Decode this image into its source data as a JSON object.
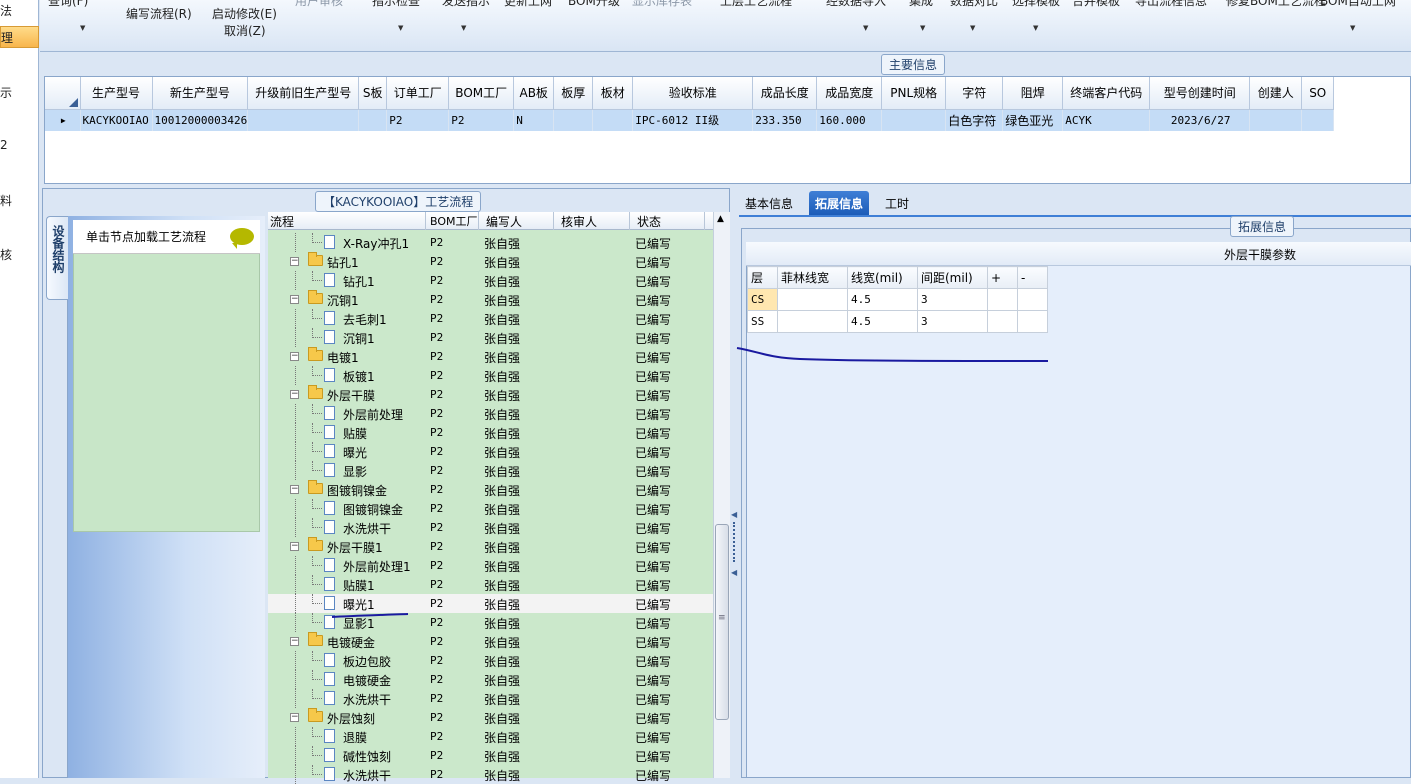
{
  "left_strip": [
    "法",
    "理",
    "示",
    "2",
    "料",
    "核"
  ],
  "toolbar": {
    "row1": [
      "查询(F)",
      "用户审核",
      "指示检查",
      "发送指示",
      "更新上网",
      "BOM升级",
      "显示库存表",
      "上层工艺流程",
      "经数据导入",
      "集成",
      "数据对比",
      "选择模板",
      "合并模板",
      "导出流程信息",
      "修复BOM工艺流程",
      "BOM自动上网"
    ],
    "compile_flow": "编写流程(R)",
    "start_modify": "启动修改(E)",
    "cancel": "取消(Z)"
  },
  "main_info": {
    "title": "主要信息",
    "columns": [
      "生产型号",
      "新生产型号",
      "升级前旧生产型号",
      "S板",
      "订单工厂",
      "BOM工厂",
      "AB板",
      "板厚",
      "板材",
      "验收标准",
      "成品长度",
      "成品宽度",
      "PNL规格",
      "字符",
      "阻焊",
      "终端客户代码",
      "型号创建时间",
      "创建人",
      "SO"
    ],
    "row": [
      "KACYKOOIAO",
      "10012000003426",
      "",
      "",
      "P2",
      "P2",
      "N",
      "",
      "",
      "IPC-6012 II级",
      "233.350",
      "160.000",
      "",
      "白色字符",
      "绿色亚光",
      "ACYK",
      "2023/6/27",
      "",
      ""
    ]
  },
  "process": {
    "title": "【KACYKOOIAO】工艺流程",
    "side_tab": "设备结构",
    "click_hint": "单击节点加载工艺流程",
    "columns": [
      "流程",
      "BOM工厂",
      "编写人",
      "核审人",
      "状态"
    ],
    "rows": [
      {
        "name": "X-Ray冲孔1",
        "level": 1,
        "factory": "P2",
        "writer": "张自强",
        "status": "已编写"
      },
      {
        "name": "钻孔1",
        "level": 0,
        "factory": "P2",
        "writer": "张自强",
        "status": "已编写"
      },
      {
        "name": "钻孔1",
        "level": 1,
        "factory": "P2",
        "writer": "张自强",
        "status": "已编写"
      },
      {
        "name": "沉铜1",
        "level": 0,
        "factory": "P2",
        "writer": "张自强",
        "status": "已编写"
      },
      {
        "name": "去毛刺1",
        "level": 1,
        "factory": "P2",
        "writer": "张自强",
        "status": "已编写"
      },
      {
        "name": "沉铜1",
        "level": 1,
        "factory": "P2",
        "writer": "张自强",
        "status": "已编写"
      },
      {
        "name": "电镀1",
        "level": 0,
        "factory": "P2",
        "writer": "张自强",
        "status": "已编写"
      },
      {
        "name": "板镀1",
        "level": 1,
        "factory": "P2",
        "writer": "张自强",
        "status": "已编写"
      },
      {
        "name": "外层干膜",
        "level": 0,
        "factory": "P2",
        "writer": "张自强",
        "status": "已编写"
      },
      {
        "name": "外层前处理",
        "level": 1,
        "factory": "P2",
        "writer": "张自强",
        "status": "已编写"
      },
      {
        "name": "贴膜",
        "level": 1,
        "factory": "P2",
        "writer": "张自强",
        "status": "已编写"
      },
      {
        "name": "曝光",
        "level": 1,
        "factory": "P2",
        "writer": "张自强",
        "status": "已编写"
      },
      {
        "name": "显影",
        "level": 1,
        "factory": "P2",
        "writer": "张自强",
        "status": "已编写"
      },
      {
        "name": "图镀铜镍金",
        "level": 0,
        "factory": "P2",
        "writer": "张自强",
        "status": "已编写"
      },
      {
        "name": "图镀铜镍金",
        "level": 1,
        "factory": "P2",
        "writer": "张自强",
        "status": "已编写"
      },
      {
        "name": "水洗烘干",
        "level": 1,
        "factory": "P2",
        "writer": "张自强",
        "status": "已编写"
      },
      {
        "name": "外层干膜1",
        "level": 0,
        "factory": "P2",
        "writer": "张自强",
        "status": "已编写"
      },
      {
        "name": "外层前处理1",
        "level": 1,
        "factory": "P2",
        "writer": "张自强",
        "status": "已编写"
      },
      {
        "name": "贴膜1",
        "level": 1,
        "factory": "P2",
        "writer": "张自强",
        "status": "已编写"
      },
      {
        "name": "曝光1",
        "level": 1,
        "factory": "P2",
        "writer": "张自强",
        "status": "已编写",
        "selected": true
      },
      {
        "name": "显影1",
        "level": 1,
        "factory": "P2",
        "writer": "张自强",
        "status": "已编写"
      },
      {
        "name": "电镀硬金",
        "level": 0,
        "factory": "P2",
        "writer": "张自强",
        "status": "已编写"
      },
      {
        "name": "板边包胶",
        "level": 1,
        "factory": "P2",
        "writer": "张自强",
        "status": "已编写"
      },
      {
        "name": "电镀硬金",
        "level": 1,
        "factory": "P2",
        "writer": "张自强",
        "status": "已编写"
      },
      {
        "name": "水洗烘干",
        "level": 1,
        "factory": "P2",
        "writer": "张自强",
        "status": "已编写"
      },
      {
        "name": "外层蚀刻",
        "level": 0,
        "factory": "P2",
        "writer": "张自强",
        "status": "已编写"
      },
      {
        "name": "退膜",
        "level": 1,
        "factory": "P2",
        "writer": "张自强",
        "status": "已编写"
      },
      {
        "name": "碱性蚀刻",
        "level": 1,
        "factory": "P2",
        "writer": "张自强",
        "status": "已编写"
      },
      {
        "name": "水洗烘干",
        "level": 1,
        "factory": "P2",
        "writer": "张自强",
        "status": "已编写"
      }
    ]
  },
  "right": {
    "tabs": [
      "基本信息",
      "拓展信息",
      "工时"
    ],
    "active_tab": 1,
    "group_title": "拓展信息",
    "grid_title": "外层干膜参数",
    "layer_columns": [
      "层",
      "菲林线宽",
      "线宽(mil)",
      "间距(mil)",
      "+",
      "-"
    ],
    "layer_rows": [
      [
        "CS",
        "",
        "4.5",
        "3",
        "",
        ""
      ],
      [
        "SS",
        "",
        "4.5",
        "3",
        "",
        ""
      ]
    ]
  }
}
